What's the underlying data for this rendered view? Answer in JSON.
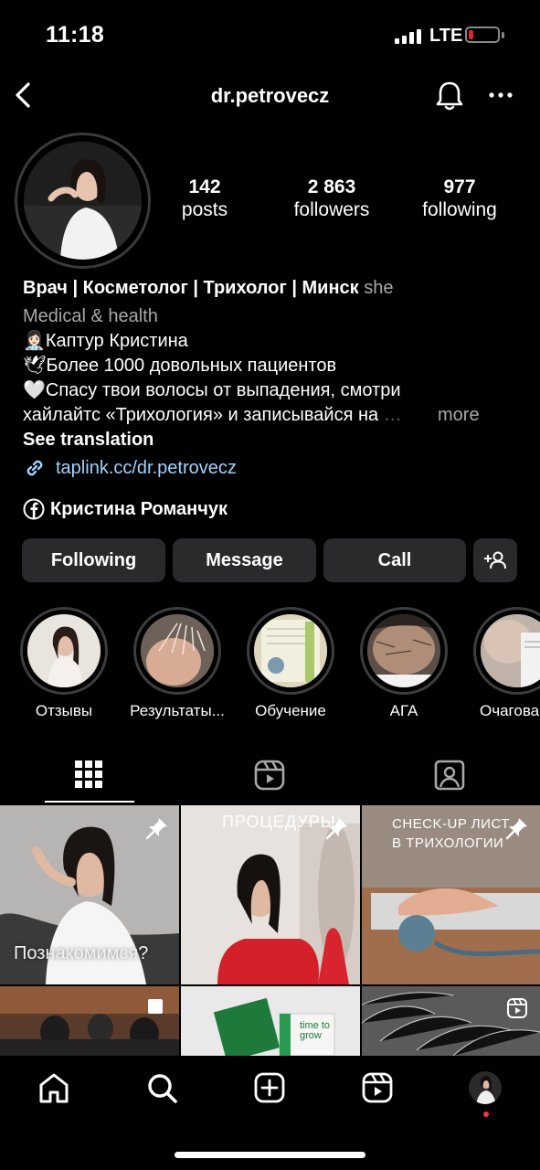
{
  "status_bar": {
    "time": "11:18",
    "network": "LTE"
  },
  "header": {
    "username": "dr.petrovecz"
  },
  "stats": [
    {
      "value": "142",
      "label": "posts"
    },
    {
      "value": "2 863",
      "label": "followers"
    },
    {
      "value": "977",
      "label": "following"
    }
  ],
  "bio": {
    "name": "Врач | Косметолог | Трихолог | Минск",
    "pronoun": "she",
    "category": "Medical & health",
    "line1_emoji": "👩🏻‍⚕️",
    "line1": "Каптур Кристина",
    "line2_emoji": "🕊",
    "line2": "Более 1000 довольных пациентов",
    "line3_emoji": "🤍",
    "line3": "Спасу твои волосы от выпадения, смотри",
    "line4": "хайлайтс «Трихология» и записывайся на",
    "more": "more",
    "see_translation": "See translation",
    "link": "taplink.cc/dr.petrovecz",
    "facebook_name": "Кристина Романчук"
  },
  "buttons": {
    "following": "Following",
    "message": "Message",
    "call": "Call"
  },
  "highlights": [
    {
      "label": "Отзывы"
    },
    {
      "label": "Результаты..."
    },
    {
      "label": "Обучение"
    },
    {
      "label": "АГА"
    },
    {
      "label": "Очагова"
    }
  ],
  "posts": [
    {
      "caption": "Познакомимся?",
      "pinned": true
    },
    {
      "caption": "ПРОЦЕДУРЫ",
      "pinned": true
    },
    {
      "caption": "CHECK-UP ЛИСТ В ТРИХОЛОГИИ",
      "pinned": true
    },
    {
      "caption": ""
    },
    {
      "caption": "time to grow"
    },
    {
      "caption": ""
    }
  ],
  "colors": {
    "background": "#000000",
    "button": "#2a2a2c",
    "link": "#9fd3ff",
    "notification_dot": "#ff3040"
  }
}
